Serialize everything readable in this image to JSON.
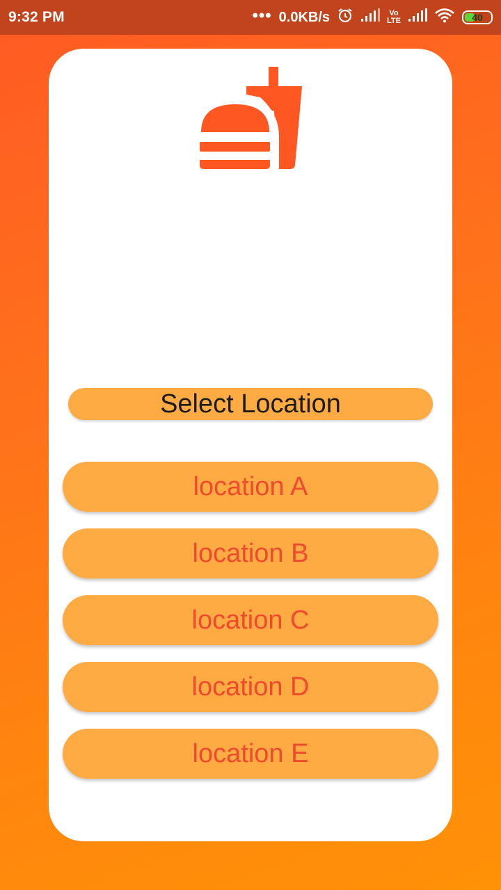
{
  "status_bar": {
    "time": "9:32 PM",
    "net_speed": "0.0KB/s",
    "network_label_top": "Vo",
    "network_label_bottom": "LTE",
    "battery_level": "40",
    "battery_fraction": 0.4
  },
  "icons": {
    "logo": "burger-and-drink-icon",
    "alarm": "alarm-icon",
    "signal": "signal-icon",
    "wifi": "wifi-icon",
    "battery": "battery-icon"
  },
  "colors": {
    "brand_orange": "#ff5722",
    "button_fill": "#ffab44",
    "button_text": "#f04a2e",
    "status_bar": "#c2441c"
  },
  "screen": {
    "title": "Select Location",
    "locations": [
      {
        "label": "location A"
      },
      {
        "label": "location B"
      },
      {
        "label": "location C"
      },
      {
        "label": "location D"
      },
      {
        "label": "location E"
      }
    ]
  }
}
